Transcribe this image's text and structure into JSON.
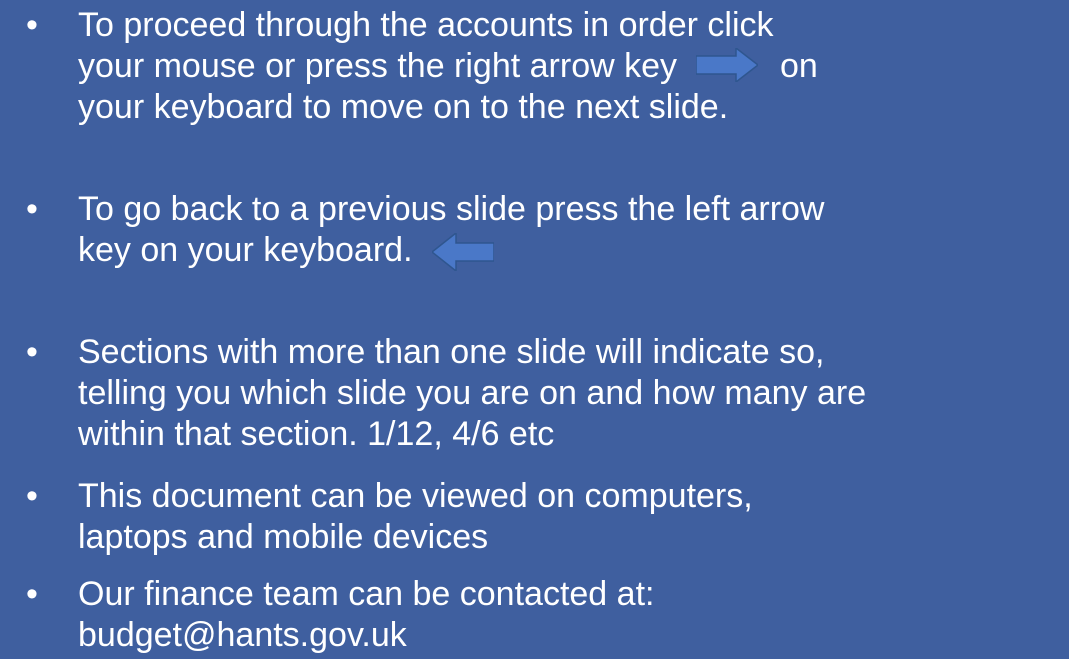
{
  "slide": {
    "bullet_symbol": "•",
    "items": [
      {
        "lines": [
          "To proceed through the accounts in order click",
          "your mouse or press the right arrow key",
          "on",
          "your keyboard to move on to the next slide."
        ],
        "icon": "right-arrow-icon"
      },
      {
        "lines": [
          "To go back to a previous slide press the left arrow",
          "key on your keyboard."
        ],
        "icon": "left-arrow-icon"
      },
      {
        "lines": [
          "Sections with more than one slide will indicate so,",
          "telling you which slide you are on and how many are",
          "within that section. 1/12, 4/6 etc"
        ]
      },
      {
        "lines": [
          "This document can be viewed on computers,",
          "laptops and mobile devices"
        ]
      },
      {
        "lines": [
          "Our finance team can be contacted at:",
          "budget@hants.gov.uk"
        ]
      }
    ],
    "colors": {
      "background": "#3f5f9f",
      "text": "#ffffff",
      "arrow_fill": "#4a78c8",
      "arrow_stroke": "#2f568f"
    }
  }
}
